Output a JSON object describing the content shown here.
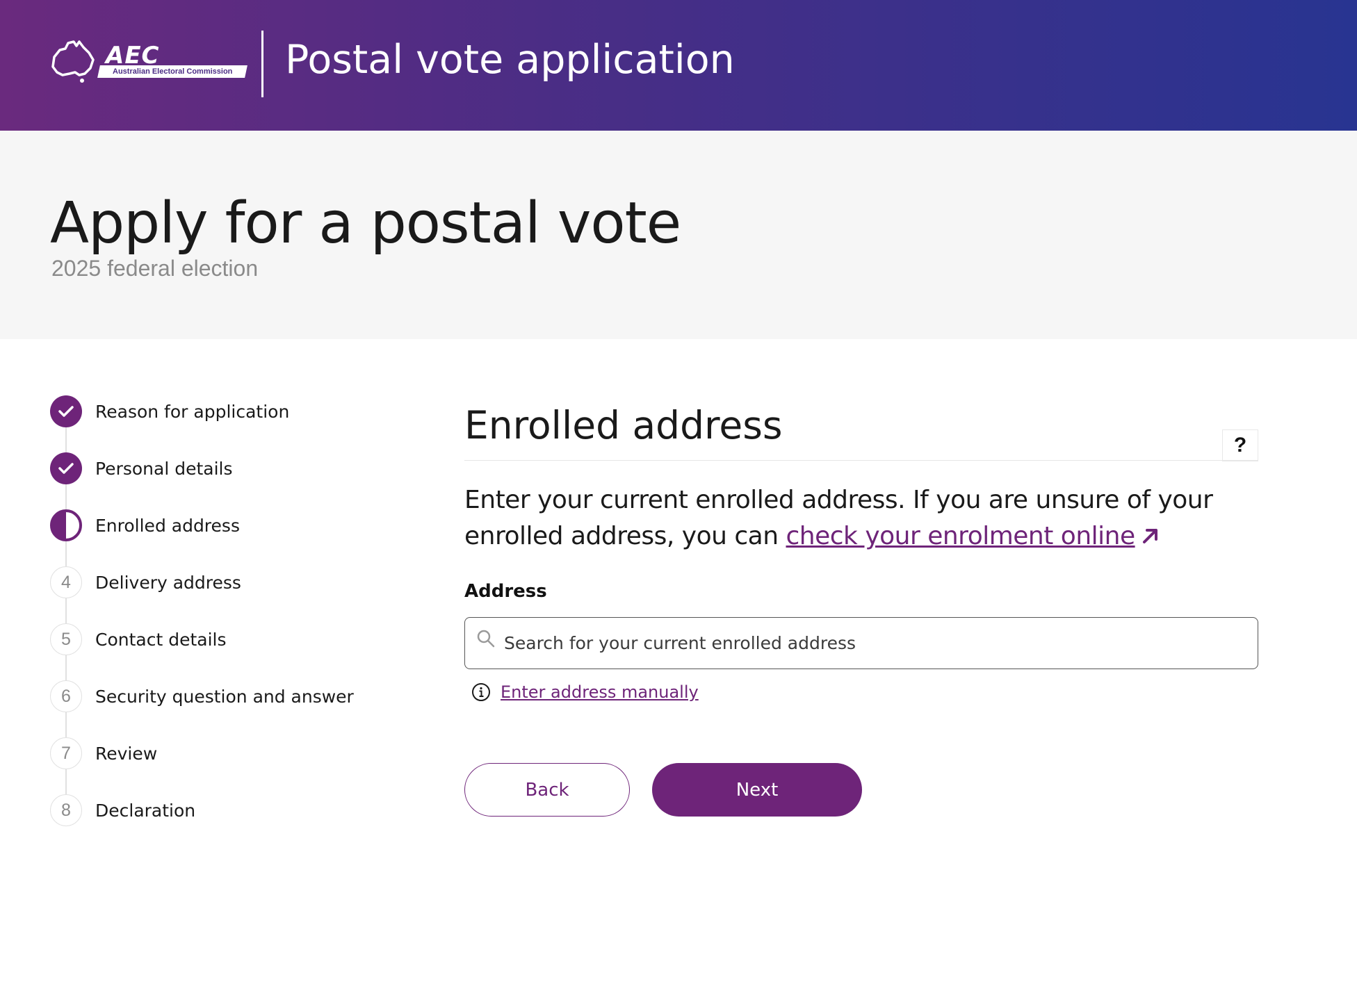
{
  "header": {
    "logo": {
      "wordmark": "AEC",
      "tagline": "Australian Electoral Commission",
      "icon": "australia-map-icon"
    },
    "title": "Postal vote application"
  },
  "hero": {
    "title": "Apply for a postal vote",
    "subtitle": "2025 federal election"
  },
  "steps": {
    "items": [
      {
        "label": "Reason for application",
        "status": "complete",
        "number": ""
      },
      {
        "label": "Personal details",
        "status": "complete",
        "number": ""
      },
      {
        "label": "Enrolled address",
        "status": "current",
        "number": ""
      },
      {
        "label": "Delivery address",
        "status": "todo",
        "number": "4"
      },
      {
        "label": "Contact details",
        "status": "todo",
        "number": "5"
      },
      {
        "label": "Security question and answer",
        "status": "todo",
        "number": "6"
      },
      {
        "label": "Review",
        "status": "todo",
        "number": "7"
      },
      {
        "label": "Declaration",
        "status": "todo",
        "number": "8"
      }
    ]
  },
  "main": {
    "section_title": "Enrolled address",
    "help_label": "?",
    "intro_text": "Enter your current enrolled address. If you are unsure of your enrolled address, you can ",
    "intro_link": "check your enrolment online",
    "address_label": "Address",
    "search_placeholder": "Search for your current enrolled address",
    "search_value": "",
    "manual_link": "Enter address manually",
    "back_label": "Back",
    "next_label": "Next"
  },
  "colors": {
    "accent": "#6e2479",
    "header_gradient_start": "#6a2a7e",
    "header_gradient_end": "#283491",
    "hero_background": "#f6f6f6"
  }
}
